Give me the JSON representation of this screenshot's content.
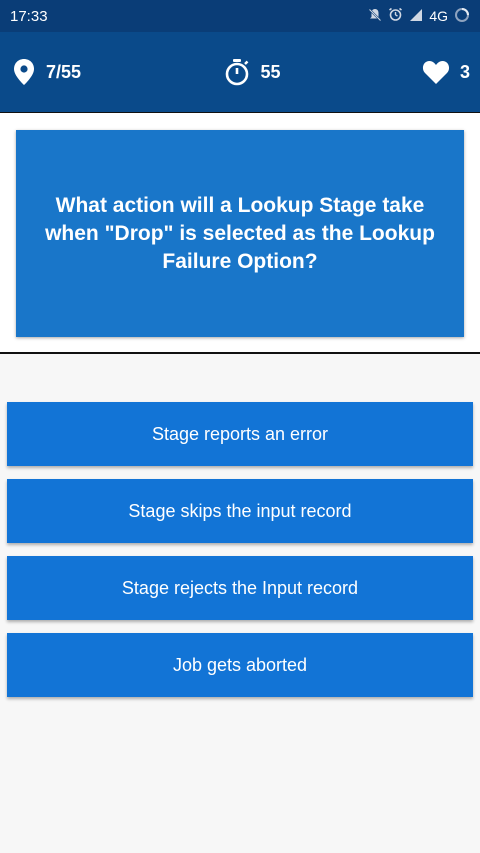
{
  "status_bar": {
    "time": "17:33",
    "network": "4G"
  },
  "header": {
    "progress": "7/55",
    "timer": "55",
    "lives": "3"
  },
  "question": {
    "text": "What action will a Lookup Stage take when \"Drop\" is selected as the Lookup Failure Option?"
  },
  "answers": [
    {
      "label": "Stage reports an error"
    },
    {
      "label": "Stage skips the input record"
    },
    {
      "label": "Stage rejects the Input record"
    },
    {
      "label": "Job gets aborted"
    }
  ],
  "colors": {
    "status_bar": "#0a3d77",
    "header": "#0a4a8a",
    "question_box": "#1976c9",
    "answer_button": "#1274d6"
  },
  "icons": {
    "progress": "location-pin-icon",
    "timer": "stopwatch-icon",
    "lives": "heart-icon"
  }
}
